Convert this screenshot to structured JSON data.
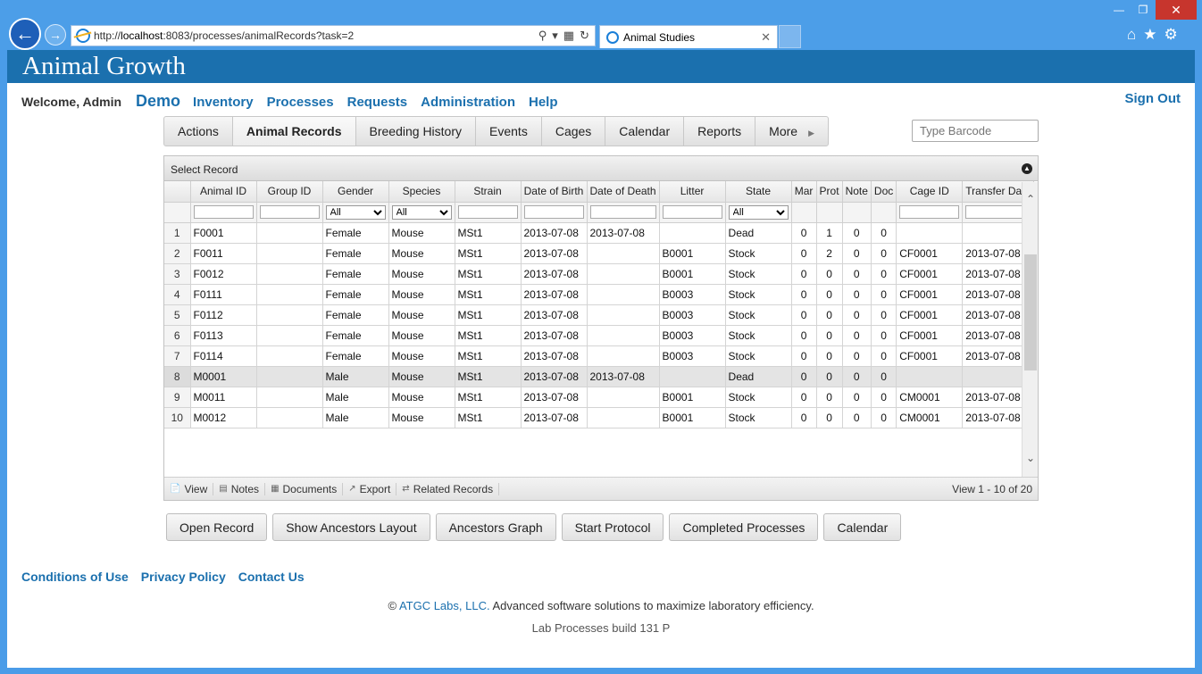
{
  "browser": {
    "url_prefix": "http://",
    "url_host": "localhost",
    "url_rest": ":8083/processes/animalRecords?task=2",
    "tab_title": "Animal Studies"
  },
  "header": {
    "banner": "Animal Growth",
    "welcome": "Welcome, Admin",
    "demo": "Demo",
    "nav": [
      "Inventory",
      "Processes",
      "Requests",
      "Administration",
      "Help"
    ],
    "signout": "Sign Out"
  },
  "tabs": [
    "Actions",
    "Animal Records",
    "Breeding History",
    "Events",
    "Cages",
    "Calendar",
    "Reports",
    "More"
  ],
  "barcode_placeholder": "Type Barcode",
  "grid": {
    "caption": "Select Record",
    "columns": [
      "Animal ID",
      "Group ID",
      "Gender",
      "Species",
      "Strain",
      "Date of Birth",
      "Date of Death",
      "Litter",
      "State",
      "Mar",
      "Prot",
      "Note",
      "Doc",
      "Cage ID",
      "Transfer Date"
    ],
    "filter_all": "All",
    "rows": [
      [
        "1",
        "F0001",
        "",
        "Female",
        "Mouse",
        "MSt1",
        "2013-07-08",
        "2013-07-08",
        "",
        "Dead",
        "0",
        "1",
        "0",
        "0",
        "",
        ""
      ],
      [
        "2",
        "F0011",
        "",
        "Female",
        "Mouse",
        "MSt1",
        "2013-07-08",
        "",
        "B0001",
        "Stock",
        "0",
        "2",
        "0",
        "0",
        "CF0001",
        "2013-07-08"
      ],
      [
        "3",
        "F0012",
        "",
        "Female",
        "Mouse",
        "MSt1",
        "2013-07-08",
        "",
        "B0001",
        "Stock",
        "0",
        "0",
        "0",
        "0",
        "CF0001",
        "2013-07-08"
      ],
      [
        "4",
        "F0111",
        "",
        "Female",
        "Mouse",
        "MSt1",
        "2013-07-08",
        "",
        "B0003",
        "Stock",
        "0",
        "0",
        "0",
        "0",
        "CF0001",
        "2013-07-08"
      ],
      [
        "5",
        "F0112",
        "",
        "Female",
        "Mouse",
        "MSt1",
        "2013-07-08",
        "",
        "B0003",
        "Stock",
        "0",
        "0",
        "0",
        "0",
        "CF0001",
        "2013-07-08"
      ],
      [
        "6",
        "F0113",
        "",
        "Female",
        "Mouse",
        "MSt1",
        "2013-07-08",
        "",
        "B0003",
        "Stock",
        "0",
        "0",
        "0",
        "0",
        "CF0001",
        "2013-07-08"
      ],
      [
        "7",
        "F0114",
        "",
        "Female",
        "Mouse",
        "MSt1",
        "2013-07-08",
        "",
        "B0003",
        "Stock",
        "0",
        "0",
        "0",
        "0",
        "CF0001",
        "2013-07-08"
      ],
      [
        "8",
        "M0001",
        "",
        "Male",
        "Mouse",
        "MSt1",
        "2013-07-08",
        "2013-07-08",
        "",
        "Dead",
        "0",
        "0",
        "0",
        "0",
        "",
        ""
      ],
      [
        "9",
        "M0011",
        "",
        "Male",
        "Mouse",
        "MSt1",
        "2013-07-08",
        "",
        "B0001",
        "Stock",
        "0",
        "0",
        "0",
        "0",
        "CM0001",
        "2013-07-08"
      ],
      [
        "10",
        "M0012",
        "",
        "Male",
        "Mouse",
        "MSt1",
        "2013-07-08",
        "",
        "B0001",
        "Stock",
        "0",
        "0",
        "0",
        "0",
        "CM0001",
        "2013-07-08"
      ]
    ],
    "selected_row": 8,
    "pager_buttons": [
      "View",
      "Notes",
      "Documents",
      "Export",
      "Related Records"
    ],
    "pager_info": "View 1 - 10 of 20"
  },
  "action_buttons": [
    "Open Record",
    "Show Ancestors Layout",
    "Ancestors Graph",
    "Start Protocol",
    "Completed Processes",
    "Calendar"
  ],
  "footer": {
    "links": [
      "Conditions of Use",
      "Privacy Policy",
      "Contact Us"
    ],
    "copy_symbol": "©",
    "company": "ATGC Labs, LLC.",
    "tagline": "Advanced software solutions to maximize laboratory efficiency.",
    "build": "Lab Processes build 131 P"
  }
}
